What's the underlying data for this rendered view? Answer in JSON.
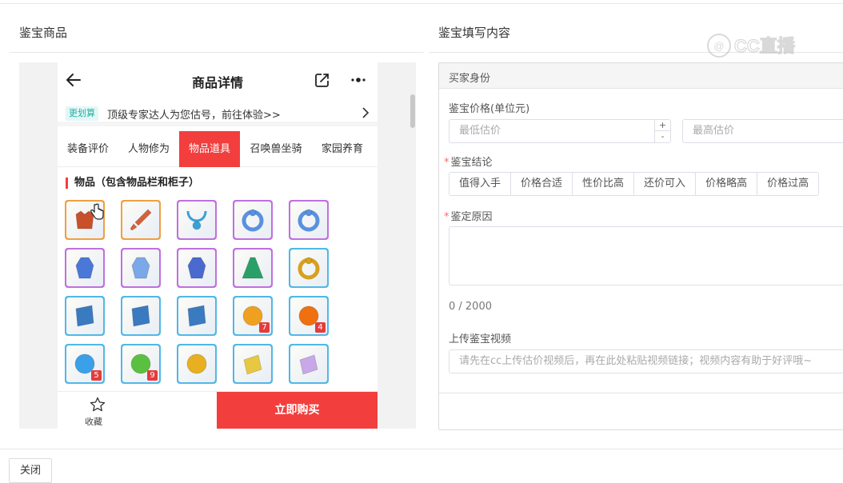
{
  "left_panel": {
    "title": "鉴宝商品",
    "phone": {
      "header_title": "商品详情",
      "promo_tag": "更划算",
      "promo_text": "顶级专家达人为您估号，前往体验>>",
      "tabs": [
        {
          "label": "装备评价",
          "active": false
        },
        {
          "label": "人物修为",
          "active": false
        },
        {
          "label": "物品道具",
          "active": true
        },
        {
          "label": "召唤兽坐骑",
          "active": false
        },
        {
          "label": "家园养育",
          "active": false
        }
      ],
      "section_title": "物品（包含物品栏和柜子）",
      "items": [
        {
          "icon": "armor-icon",
          "frame": "#f0a040",
          "fill": "#c8502a",
          "badge": ""
        },
        {
          "icon": "sword-icon",
          "frame": "#f0a040",
          "fill": "#d6603a",
          "badge": ""
        },
        {
          "icon": "necklace-icon",
          "frame": "#c070e0",
          "fill": "#3aa0d8",
          "badge": ""
        },
        {
          "icon": "ring-icon",
          "frame": "#c070e0",
          "fill": "#5a90e0",
          "badge": ""
        },
        {
          "icon": "ring-icon",
          "frame": "#c070e0",
          "fill": "#5a90e0",
          "badge": ""
        },
        {
          "icon": "robe-icon",
          "frame": "#c070e0",
          "fill": "#4a78d8",
          "badge": ""
        },
        {
          "icon": "robe-icon",
          "frame": "#c070e0",
          "fill": "#7aa8e8",
          "badge": ""
        },
        {
          "icon": "robe-icon",
          "frame": "#c070e0",
          "fill": "#4a6ad0",
          "badge": ""
        },
        {
          "icon": "cloak-icon",
          "frame": "#c070e0",
          "fill": "#2aa068",
          "badge": ""
        },
        {
          "icon": "ring-icon",
          "frame": "#50b8e8",
          "fill": "#d8a020",
          "badge": ""
        },
        {
          "icon": "book-icon",
          "frame": "#50b8e8",
          "fill": "#3a7ac0",
          "badge": ""
        },
        {
          "icon": "book-icon",
          "frame": "#50b8e8",
          "fill": "#3a7ac0",
          "badge": ""
        },
        {
          "icon": "book-icon",
          "frame": "#50b8e8",
          "fill": "#3a7ac0",
          "badge": ""
        },
        {
          "icon": "orb-icon",
          "frame": "#50b8e8",
          "fill": "#f0a020",
          "badge": "7"
        },
        {
          "icon": "orb-icon",
          "frame": "#50b8e8",
          "fill": "#f07010",
          "badge": "4"
        },
        {
          "icon": "orb-icon",
          "frame": "#50b8e8",
          "fill": "#3aa0e8",
          "badge": "5"
        },
        {
          "icon": "orb-icon",
          "frame": "#50b8e8",
          "fill": "#5ac040",
          "badge": "9"
        },
        {
          "icon": "orb-icon",
          "frame": "#50b8e8",
          "fill": "#e8b020",
          "badge": ""
        },
        {
          "icon": "bag-icon",
          "frame": "#50b8e8",
          "fill": "#e8c840",
          "badge": ""
        },
        {
          "icon": "bag-icon",
          "frame": "#50b8e8",
          "fill": "#c8a8e8",
          "badge": ""
        }
      ],
      "favorite_label": "收藏",
      "buy_label": "立即购买"
    }
  },
  "right_panel": {
    "title": "鉴宝填写内容",
    "section_header": "买家身份",
    "price_label": "鉴宝价格(单位元)",
    "min_price_placeholder": "最低估价",
    "max_price_placeholder": "最高估价",
    "conclusion_label": "鉴宝结论",
    "conclusion_options": [
      "值得入手",
      "价格合适",
      "性价比高",
      "还价可入",
      "价格略高",
      "价格过高"
    ],
    "reason_label": "鉴定原因",
    "reason_counter": "0 / 2000",
    "video_label": "上传鉴宝视频",
    "video_placeholder": "请先在cc上传估价视频后，再在此处粘贴视频链接；视频内容有助于好评哦~",
    "watermark_text": "CC直播"
  },
  "footer": {
    "close_label": "关闭"
  },
  "colors": {
    "accent_red": "#f33e3e",
    "required_star": "#f56c6c",
    "promo_teal": "#22b0a8"
  }
}
